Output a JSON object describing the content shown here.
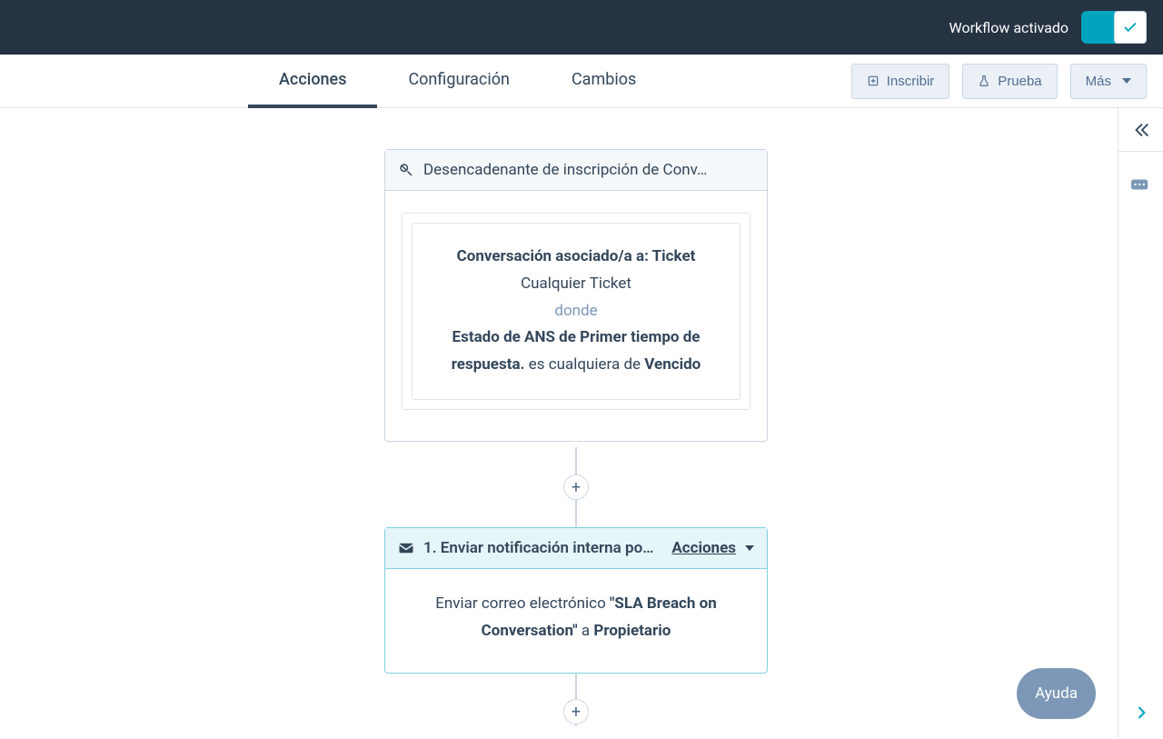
{
  "header": {
    "workflow_status": "Workflow activado"
  },
  "tabs": {
    "actions": "Acciones",
    "settings": "Configuración",
    "changes": "Cambios"
  },
  "nav_buttons": {
    "enroll": "Inscribir",
    "test": "Prueba",
    "more": "Más"
  },
  "trigger": {
    "title": "Desencadenante de inscripción de Conv…",
    "assoc_label": "Conversación asociado/a a: Ticket",
    "assoc_value": "Cualquier Ticket",
    "where": "donde",
    "property": "Estado de ANS de Primer tiempo de respuesta.",
    "operator": "es cualquiera de",
    "value": "Vencido"
  },
  "action": {
    "title": "1. Enviar notificación interna po…",
    "menu": "Acciones",
    "body_prefix": "Enviar correo electrónico",
    "body_email": "\"SLA Breach on Conversation\"",
    "body_to": "a",
    "body_recipient": "Propietario"
  },
  "help": "Ayuda",
  "plus": "+"
}
